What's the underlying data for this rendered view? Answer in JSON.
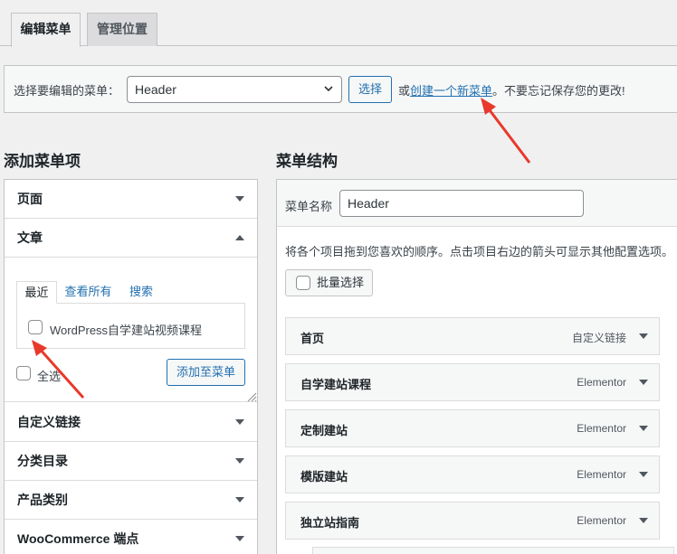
{
  "tabs": [
    {
      "label": "编辑菜单",
      "active": true
    },
    {
      "label": "管理位置",
      "active": false
    }
  ],
  "manage": {
    "label": "选择要编辑的菜单：",
    "selected_menu": "Header",
    "select_button": "选择",
    "hint_prefix": "或",
    "hint_link": "创建一个新菜单",
    "hint_suffix": "。不要忘记保存您的更改!"
  },
  "add_items": {
    "heading": "添加菜单项",
    "sections": [
      {
        "label": "页面",
        "expanded": false
      },
      {
        "label": "文章",
        "expanded": true
      },
      {
        "label": "自定义链接",
        "expanded": false
      },
      {
        "label": "分类目录",
        "expanded": false
      },
      {
        "label": "产品类别",
        "expanded": false
      },
      {
        "label": "WooCommerce 端点",
        "expanded": false
      }
    ],
    "post_tabs": [
      "最近",
      "查看所有",
      "搜索"
    ],
    "posts": [
      "WordPress自学建站视频课程"
    ],
    "select_all": "全选",
    "add_button": "添加至菜单"
  },
  "structure": {
    "heading": "菜单结构",
    "name_label": "菜单名称",
    "name_value": "Header",
    "description": "将各个项目拖到您喜欢的顺序。点击项目右边的箭头可显示其他配置选项。",
    "bulk_select": "批量选择",
    "items": [
      {
        "title": "首页",
        "type": "自定义链接"
      },
      {
        "title": "自学建站课程",
        "type": "Elementor"
      },
      {
        "title": "定制建站",
        "type": "Elementor"
      },
      {
        "title": "模版建站",
        "type": "Elementor"
      },
      {
        "title": "独立站指南",
        "type": "Elementor"
      }
    ]
  },
  "colors": {
    "accent": "#2271b1",
    "annotation": "#e8392b"
  }
}
